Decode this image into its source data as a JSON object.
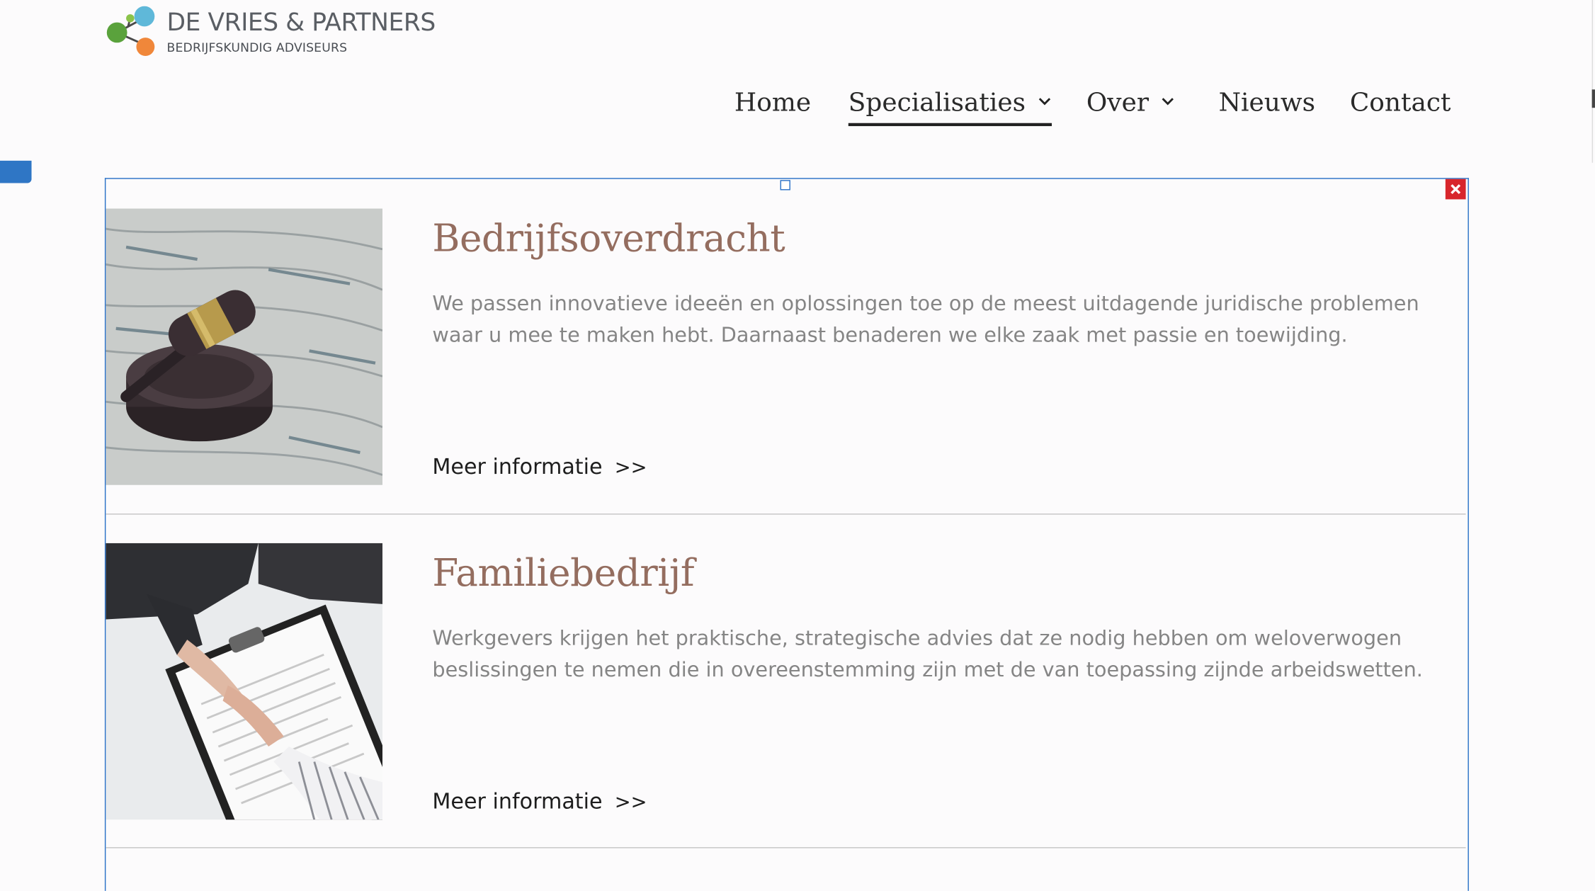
{
  "brand": {
    "title": "DE VRIES & PARTNERS",
    "subtitle": "BEDRIJFSKUNDIG ADVISEURS"
  },
  "nav": {
    "items": [
      {
        "label": "Home",
        "has_dropdown": false,
        "active": false
      },
      {
        "label": "Specialisaties",
        "has_dropdown": true,
        "active": true
      },
      {
        "label": "Over",
        "has_dropdown": true,
        "active": false
      },
      {
        "label": "Nieuws",
        "has_dropdown": false,
        "active": false
      },
      {
        "label": "Contact",
        "has_dropdown": false,
        "active": false
      }
    ]
  },
  "cards": [
    {
      "title": "Bedrijfsoverdracht",
      "text": "We passen innovatieve ideeën en oplossingen toe op de meest uitdagende juridische problemen waar u mee te maken hebt. Daarnaast benaderen we elke zaak met passie en toewijding.",
      "link": "Meer informatie",
      "link_arrow": ">>",
      "image": "gavel-on-wood-image"
    },
    {
      "title": "Familiebedrijf",
      "text": "Werkgevers krijgen het praktische, strategische advies dat ze nodig hebben om weloverwogen beslissingen te nemen die in overeenstemming zijn met de van toepassing zijnde arbeidswetten.",
      "link": "Meer informatie",
      "link_arrow": ">>",
      "image": "handshake-contract-image"
    }
  ],
  "colors": {
    "title": "#946d5f",
    "body_text": "#858585",
    "frame": "#2b72c8",
    "close": "#d8262c",
    "logo_green": "#5aa23c",
    "logo_blue": "#5fb8d9",
    "logo_orange": "#f0873a"
  }
}
